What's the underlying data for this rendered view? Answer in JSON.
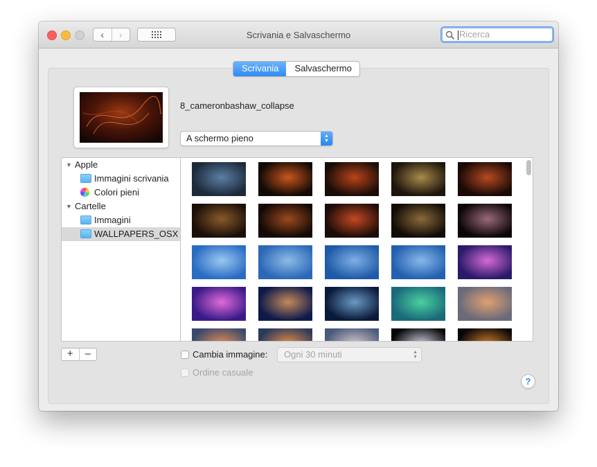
{
  "window": {
    "title": "Scrivania e Salvaschermo",
    "nav_back": "‹",
    "nav_forward": "›"
  },
  "search": {
    "placeholder": "Ricerca"
  },
  "tabs": [
    {
      "label": "Scrivania",
      "active": true
    },
    {
      "label": "Salvaschermo",
      "active": false
    }
  ],
  "current": {
    "image_name": "8_cameronbashaw_collapse",
    "fit_option": "A schermo pieno"
  },
  "sidebar": {
    "sections": [
      {
        "label": "Apple",
        "items": [
          {
            "label": "Immagini scrivania",
            "icon": "folder-icon"
          },
          {
            "label": "Colori pieni",
            "icon": "color-wheel-icon"
          }
        ]
      },
      {
        "label": "Cartelle",
        "items": [
          {
            "label": "Immagini",
            "icon": "camera-folder-icon"
          },
          {
            "label": "WALLPAPERS_OSX",
            "icon": "folder-icon",
            "selected": true
          }
        ]
      }
    ]
  },
  "thumbnails": [
    [
      "#1c2a3a",
      "#5b7fa6"
    ],
    [
      "#120a06",
      "#c8561a"
    ],
    [
      "#1a0d08",
      "#b9431a"
    ],
    [
      "#1d150c",
      "#a88a4a"
    ],
    [
      "#1a0906",
      "#b64a22"
    ],
    [
      "#1b0f08",
      "#8a5a2a"
    ],
    [
      "#140906",
      "#9a4a1e"
    ],
    [
      "#1e0c08",
      "#c24a22"
    ],
    [
      "#120c06",
      "#8a6a3a"
    ],
    [
      "#0c0608",
      "#9a6a7a"
    ],
    [
      "#2a6cc4",
      "#9cc8f0"
    ],
    [
      "#2c68b8",
      "#8ebce8"
    ],
    [
      "#1f5aa8",
      "#7fb0e4"
    ],
    [
      "#2460b0",
      "#88b8ea"
    ],
    [
      "#2a1a6a",
      "#d66ad6"
    ],
    [
      "#3a1a8a",
      "#e06ad8"
    ],
    [
      "#0e1a4a",
      "#c48a5a"
    ],
    [
      "#0a1a3a",
      "#6a9ac4"
    ],
    [
      "#1a6a7a",
      "#4ad0a0"
    ],
    [
      "#6a6a7a",
      "#e0a070"
    ],
    [
      "#3a4a6a",
      "#e08a5a"
    ],
    [
      "#2a3a5a",
      "#e48a4a"
    ],
    [
      "#4a5a7a",
      "#d0c4c8"
    ],
    [
      "#060608",
      "#c8c8d8"
    ],
    [
      "#0a0608",
      "#c87a2a"
    ]
  ],
  "bottom": {
    "add_label": "+",
    "remove_label": "–",
    "change_label": "Cambia immagine:",
    "interval": "Ogni 30 minuti",
    "random_label": "Ordine casuale",
    "help_label": "?"
  },
  "colors": {
    "accent": "#2f8bf4",
    "selection": "#d9d9d9"
  }
}
